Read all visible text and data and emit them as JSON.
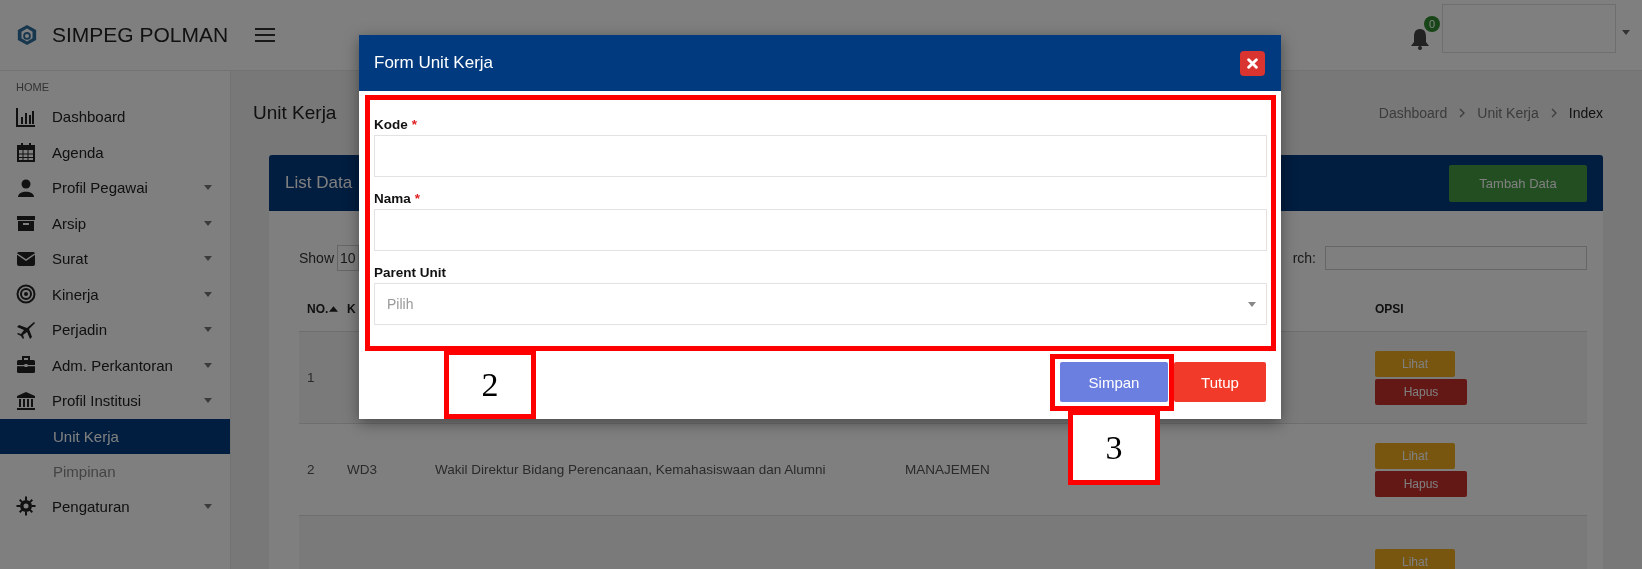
{
  "app": {
    "brand": "SIMPEG POLMAN",
    "notifications": "0"
  },
  "sidebar": {
    "section": "HOME",
    "items": [
      {
        "label": "Dashboard",
        "submenu": false,
        "selected": false
      },
      {
        "label": "Agenda",
        "submenu": false,
        "selected": false
      },
      {
        "label": "Profil Pegawai",
        "submenu": true,
        "selected": false
      },
      {
        "label": "Arsip",
        "submenu": true,
        "selected": false
      },
      {
        "label": "Surat",
        "submenu": true,
        "selected": false
      },
      {
        "label": "Kinerja",
        "submenu": true,
        "selected": false
      },
      {
        "label": "Perjadin",
        "submenu": true,
        "selected": false
      },
      {
        "label": "Adm. Perkantoran",
        "submenu": true,
        "selected": false
      },
      {
        "label": "Profil Institusi",
        "submenu": true,
        "selected": false,
        "children": [
          {
            "label": "Unit Kerja",
            "selected": true
          },
          {
            "label": "Pimpinan",
            "selected": false
          }
        ]
      },
      {
        "label": "Pengaturan",
        "submenu": true,
        "selected": false
      }
    ]
  },
  "page": {
    "title": "Unit Kerja",
    "breadcrumb": [
      {
        "label": "Dashboard",
        "current": false
      },
      {
        "label": "Unit Kerja",
        "current": false
      },
      {
        "label": "Index",
        "current": true
      }
    ]
  },
  "card": {
    "title": "List Data",
    "add_button": "Tambah Data",
    "show_label": "Show",
    "page_size": "10",
    "search_label": "rch:"
  },
  "table": {
    "columns": [
      {
        "label": "NO.",
        "sorted": true
      },
      {
        "label": "K",
        "sorted": false
      },
      {
        "label": "OPSI",
        "sorted": false
      }
    ],
    "rows": [
      {
        "no": "1",
        "actions": [
          "Lihat",
          "Hapus"
        ]
      },
      {
        "no": "2",
        "code": "WD3",
        "name": "Wakil Direktur Bidang Perencanaan, Kemahasiswaan dan Alumni",
        "group": "MANAJEMEN",
        "actions": [
          "Lihat",
          "Hapus"
        ]
      },
      {
        "actions": [
          "Lihat"
        ]
      }
    ]
  },
  "modal": {
    "title": "Form Unit Kerja",
    "fields": [
      {
        "kind": "text",
        "label": "Kode",
        "required_mark": "*"
      },
      {
        "kind": "text",
        "label": "Nama",
        "required_mark": "*"
      },
      {
        "kind": "select",
        "label": "Parent Unit",
        "placeholder": "Pilih"
      }
    ],
    "buttons": [
      {
        "label": "Simpan",
        "kind": "primary"
      },
      {
        "label": "Tutup",
        "kind": "danger"
      }
    ]
  },
  "annotations": [
    {
      "label": "2",
      "kind": "form"
    },
    {
      "label": "3",
      "kind": "save"
    }
  ]
}
